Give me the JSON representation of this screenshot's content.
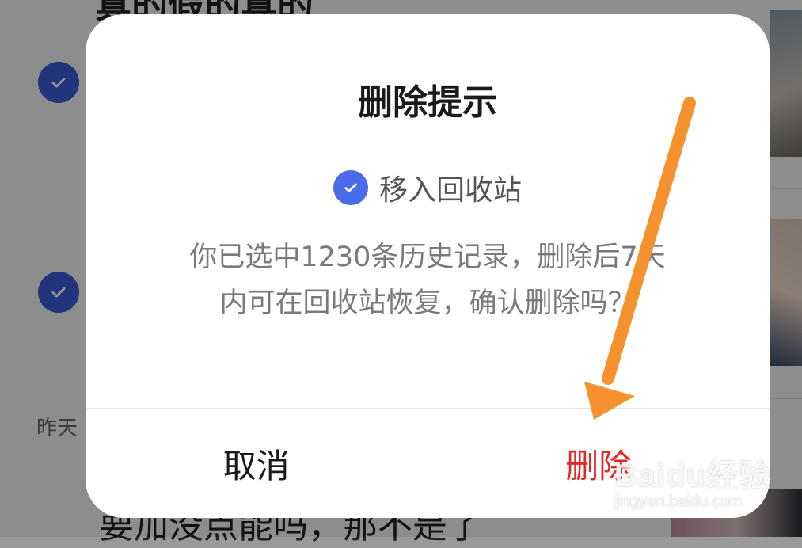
{
  "background": {
    "title_text": "真的假的真的",
    "date_label": "昨天",
    "bottom_text": "要加没点能吗，那不是了"
  },
  "dialog": {
    "title": "删除提示",
    "recycle_option": {
      "label": "移入回收站",
      "checked": true
    },
    "message_line1": "你已选中1230条历史记录，删除后7天",
    "message_line2": "内可在回收站恢复，确认删除吗？",
    "cancel_label": "取消",
    "delete_label": "删除"
  },
  "watermark": {
    "brand": "Baidu经验",
    "url": "jingyan.baidu.com"
  },
  "colors": {
    "accent": "#4a6bea",
    "danger": "#e02a2a",
    "arrow": "#f5922f"
  }
}
